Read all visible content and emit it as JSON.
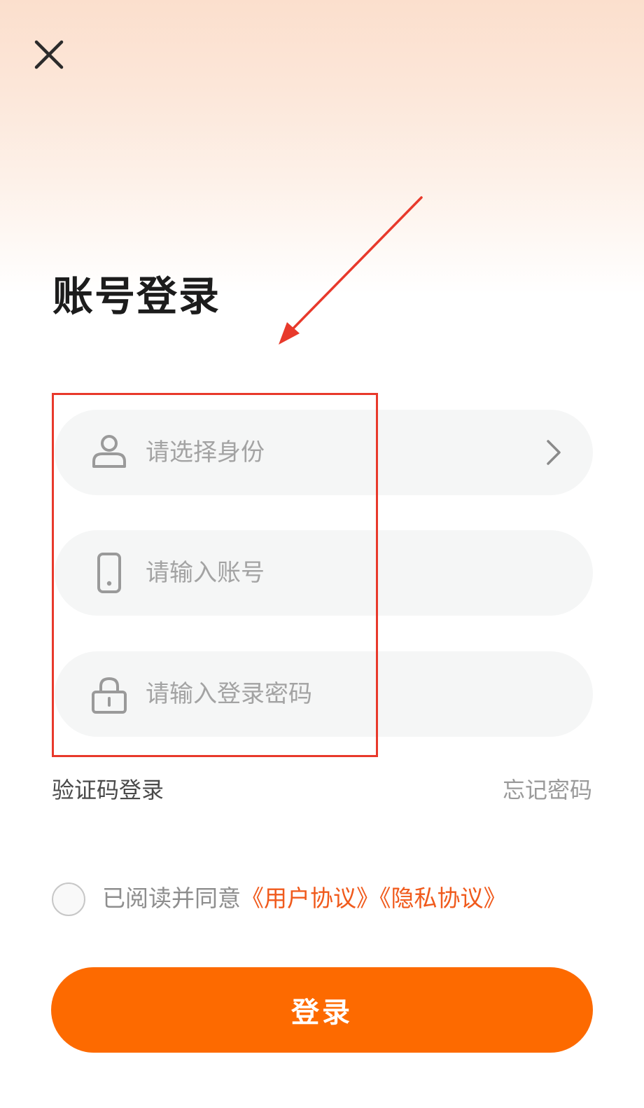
{
  "header": {
    "close_icon": "close-icon",
    "title": "账号登录"
  },
  "form": {
    "identity": {
      "icon": "user-icon",
      "placeholder": "请选择身份",
      "trailing_icon": "chevron-right-icon"
    },
    "account": {
      "icon": "phone-icon",
      "placeholder": "请输入账号",
      "value": ""
    },
    "password": {
      "icon": "lock-icon",
      "placeholder": "请输入登录密码",
      "value": ""
    }
  },
  "links": {
    "sms_login": "验证码登录",
    "forgot_password": "忘记密码"
  },
  "agreement": {
    "checked": false,
    "prefix": "已阅读并同意",
    "user_agreement": "《用户协议》",
    "privacy_policy": "《隐私协议》"
  },
  "submit": {
    "label": "登录"
  },
  "colors": {
    "accent": "#fd6a00",
    "link_orange": "#f05a1c",
    "field_bg": "#f5f6f6",
    "annotation_red": "#e8392b"
  }
}
